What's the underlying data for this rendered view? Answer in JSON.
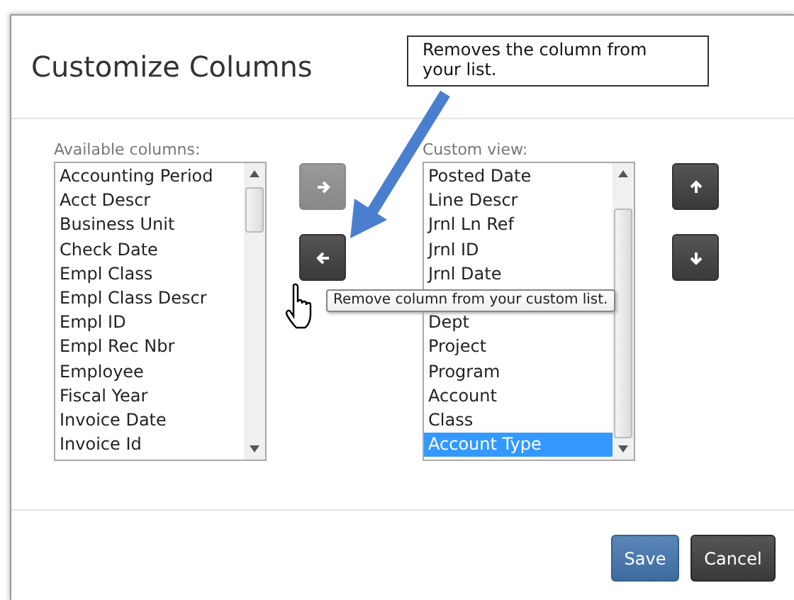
{
  "dialog": {
    "title": "Customize Columns"
  },
  "available": {
    "label": "Available columns:",
    "items": [
      {
        "label": "Accounting Period",
        "selected": false
      },
      {
        "label": "Acct Descr",
        "selected": false
      },
      {
        "label": "Business Unit",
        "selected": false
      },
      {
        "label": "Check Date",
        "selected": false
      },
      {
        "label": "Empl Class",
        "selected": false
      },
      {
        "label": "Empl Class Descr",
        "selected": false
      },
      {
        "label": "Empl ID",
        "selected": false
      },
      {
        "label": "Empl Rec Nbr",
        "selected": false
      },
      {
        "label": "Employee",
        "selected": false
      },
      {
        "label": "Fiscal Year",
        "selected": false
      },
      {
        "label": "Invoice Date",
        "selected": false
      },
      {
        "label": "Invoice Id",
        "selected": false
      }
    ]
  },
  "move_buttons": [
    {
      "kind": "right",
      "disabled": true
    },
    {
      "kind": "left",
      "disabled": false
    }
  ],
  "custom": {
    "label": "Custom view:",
    "items": [
      {
        "label": "Posted Date",
        "selected": false
      },
      {
        "label": "Line Descr",
        "selected": false
      },
      {
        "label": "Jrnl Ln Ref",
        "selected": false
      },
      {
        "label": "Jrnl ID",
        "selected": false
      },
      {
        "label": "Jrnl Date",
        "selected": false
      },
      {
        "label": "Dept",
        "selected": false
      },
      {
        "label": "Project",
        "selected": false
      },
      {
        "label": "Program",
        "selected": false
      },
      {
        "label": "Account",
        "selected": false
      },
      {
        "label": "Class",
        "selected": false
      },
      {
        "label": "Account Type",
        "selected": true
      }
    ]
  },
  "order_buttons": [
    {
      "kind": "up",
      "disabled": false
    },
    {
      "kind": "down",
      "disabled": false
    }
  ],
  "tooltip": "Remove column from your custom list.",
  "callout": "Removes the column from your list.",
  "footer_buttons": [
    {
      "label": "Save",
      "kind": "primary"
    },
    {
      "label": "Cancel",
      "kind": "secondary"
    }
  ]
}
